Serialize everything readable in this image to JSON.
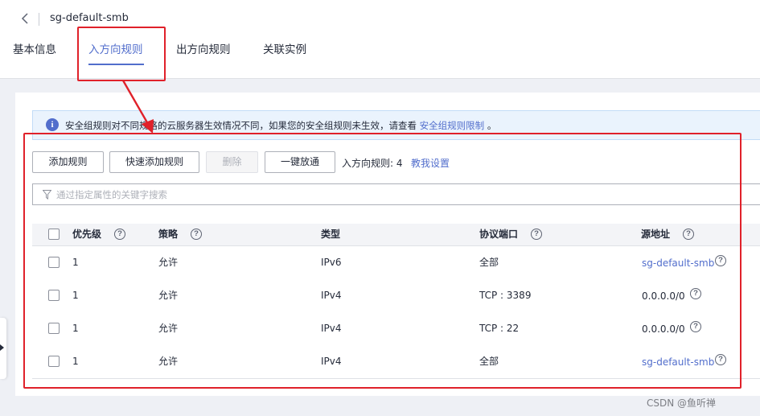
{
  "header": {
    "title": "sg-default-smb",
    "tabs": [
      {
        "label": "基本信息"
      },
      {
        "label": "入方向规则"
      },
      {
        "label": "出方向规则"
      },
      {
        "label": "关联实例"
      }
    ]
  },
  "notice": {
    "text": "安全组规则对不同规格的云服务器生效情况不同，如果您的安全组规则未生效，请查看",
    "link": "安全组规则限制",
    "suffix": "。"
  },
  "toolbar": {
    "add_rule": "添加规则",
    "quick_add_rule": "快速添加规则",
    "delete": "删除",
    "one_click_allow": "一键放通",
    "rule_count": "入方向规则: 4",
    "help_link": "教我设置"
  },
  "search": {
    "placeholder": "通过指定属性的关键字搜索"
  },
  "table": {
    "headers": {
      "priority": "优先级",
      "policy": "策略",
      "type": "类型",
      "protocol_port": "协议端口",
      "source": "源地址"
    },
    "rows": [
      {
        "priority": "1",
        "policy": "允许",
        "type": "IPv6",
        "protocol_port": "全部",
        "source": "sg-default-smb"
      },
      {
        "priority": "1",
        "policy": "允许",
        "type": "IPv4",
        "protocol_port": "TCP : 3389",
        "source": "0.0.0.0/0"
      },
      {
        "priority": "1",
        "policy": "允许",
        "type": "IPv4",
        "protocol_port": "TCP : 22",
        "source": "0.0.0.0/0"
      },
      {
        "priority": "1",
        "policy": "允许",
        "type": "IPv4",
        "protocol_port": "全部",
        "source": "sg-default-smb"
      }
    ]
  },
  "watermark": "CSDN @鱼听禅",
  "colors": {
    "accent": "#526ecc",
    "annotation_red": "#e0212a",
    "notice_bg": "#eaf3fd"
  }
}
